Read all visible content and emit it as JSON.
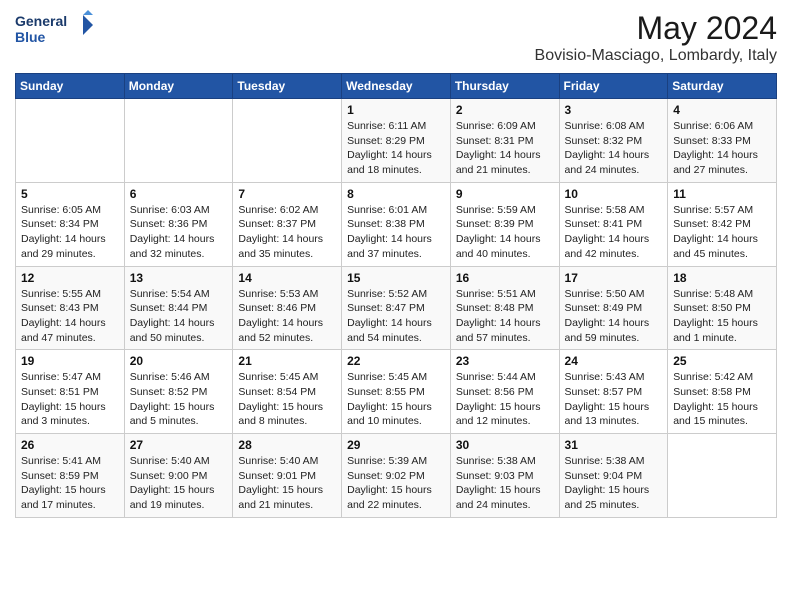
{
  "header": {
    "logo_line1": "General",
    "logo_line2": "Blue",
    "title": "May 2024",
    "subtitle": "Bovisio-Masciago, Lombardy, Italy"
  },
  "weekdays": [
    "Sunday",
    "Monday",
    "Tuesday",
    "Wednesday",
    "Thursday",
    "Friday",
    "Saturday"
  ],
  "weeks": [
    [
      {
        "day": "",
        "info": ""
      },
      {
        "day": "",
        "info": ""
      },
      {
        "day": "",
        "info": ""
      },
      {
        "day": "1",
        "info": "Sunrise: 6:11 AM\nSunset: 8:29 PM\nDaylight: 14 hours\nand 18 minutes."
      },
      {
        "day": "2",
        "info": "Sunrise: 6:09 AM\nSunset: 8:31 PM\nDaylight: 14 hours\nand 21 minutes."
      },
      {
        "day": "3",
        "info": "Sunrise: 6:08 AM\nSunset: 8:32 PM\nDaylight: 14 hours\nand 24 minutes."
      },
      {
        "day": "4",
        "info": "Sunrise: 6:06 AM\nSunset: 8:33 PM\nDaylight: 14 hours\nand 27 minutes."
      }
    ],
    [
      {
        "day": "5",
        "info": "Sunrise: 6:05 AM\nSunset: 8:34 PM\nDaylight: 14 hours\nand 29 minutes."
      },
      {
        "day": "6",
        "info": "Sunrise: 6:03 AM\nSunset: 8:36 PM\nDaylight: 14 hours\nand 32 minutes."
      },
      {
        "day": "7",
        "info": "Sunrise: 6:02 AM\nSunset: 8:37 PM\nDaylight: 14 hours\nand 35 minutes."
      },
      {
        "day": "8",
        "info": "Sunrise: 6:01 AM\nSunset: 8:38 PM\nDaylight: 14 hours\nand 37 minutes."
      },
      {
        "day": "9",
        "info": "Sunrise: 5:59 AM\nSunset: 8:39 PM\nDaylight: 14 hours\nand 40 minutes."
      },
      {
        "day": "10",
        "info": "Sunrise: 5:58 AM\nSunset: 8:41 PM\nDaylight: 14 hours\nand 42 minutes."
      },
      {
        "day": "11",
        "info": "Sunrise: 5:57 AM\nSunset: 8:42 PM\nDaylight: 14 hours\nand 45 minutes."
      }
    ],
    [
      {
        "day": "12",
        "info": "Sunrise: 5:55 AM\nSunset: 8:43 PM\nDaylight: 14 hours\nand 47 minutes."
      },
      {
        "day": "13",
        "info": "Sunrise: 5:54 AM\nSunset: 8:44 PM\nDaylight: 14 hours\nand 50 minutes."
      },
      {
        "day": "14",
        "info": "Sunrise: 5:53 AM\nSunset: 8:46 PM\nDaylight: 14 hours\nand 52 minutes."
      },
      {
        "day": "15",
        "info": "Sunrise: 5:52 AM\nSunset: 8:47 PM\nDaylight: 14 hours\nand 54 minutes."
      },
      {
        "day": "16",
        "info": "Sunrise: 5:51 AM\nSunset: 8:48 PM\nDaylight: 14 hours\nand 57 minutes."
      },
      {
        "day": "17",
        "info": "Sunrise: 5:50 AM\nSunset: 8:49 PM\nDaylight: 14 hours\nand 59 minutes."
      },
      {
        "day": "18",
        "info": "Sunrise: 5:48 AM\nSunset: 8:50 PM\nDaylight: 15 hours\nand 1 minute."
      }
    ],
    [
      {
        "day": "19",
        "info": "Sunrise: 5:47 AM\nSunset: 8:51 PM\nDaylight: 15 hours\nand 3 minutes."
      },
      {
        "day": "20",
        "info": "Sunrise: 5:46 AM\nSunset: 8:52 PM\nDaylight: 15 hours\nand 5 minutes."
      },
      {
        "day": "21",
        "info": "Sunrise: 5:45 AM\nSunset: 8:54 PM\nDaylight: 15 hours\nand 8 minutes."
      },
      {
        "day": "22",
        "info": "Sunrise: 5:45 AM\nSunset: 8:55 PM\nDaylight: 15 hours\nand 10 minutes."
      },
      {
        "day": "23",
        "info": "Sunrise: 5:44 AM\nSunset: 8:56 PM\nDaylight: 15 hours\nand 12 minutes."
      },
      {
        "day": "24",
        "info": "Sunrise: 5:43 AM\nSunset: 8:57 PM\nDaylight: 15 hours\nand 13 minutes."
      },
      {
        "day": "25",
        "info": "Sunrise: 5:42 AM\nSunset: 8:58 PM\nDaylight: 15 hours\nand 15 minutes."
      }
    ],
    [
      {
        "day": "26",
        "info": "Sunrise: 5:41 AM\nSunset: 8:59 PM\nDaylight: 15 hours\nand 17 minutes."
      },
      {
        "day": "27",
        "info": "Sunrise: 5:40 AM\nSunset: 9:00 PM\nDaylight: 15 hours\nand 19 minutes."
      },
      {
        "day": "28",
        "info": "Sunrise: 5:40 AM\nSunset: 9:01 PM\nDaylight: 15 hours\nand 21 minutes."
      },
      {
        "day": "29",
        "info": "Sunrise: 5:39 AM\nSunset: 9:02 PM\nDaylight: 15 hours\nand 22 minutes."
      },
      {
        "day": "30",
        "info": "Sunrise: 5:38 AM\nSunset: 9:03 PM\nDaylight: 15 hours\nand 24 minutes."
      },
      {
        "day": "31",
        "info": "Sunrise: 5:38 AM\nSunset: 9:04 PM\nDaylight: 15 hours\nand 25 minutes."
      },
      {
        "day": "",
        "info": ""
      }
    ]
  ]
}
